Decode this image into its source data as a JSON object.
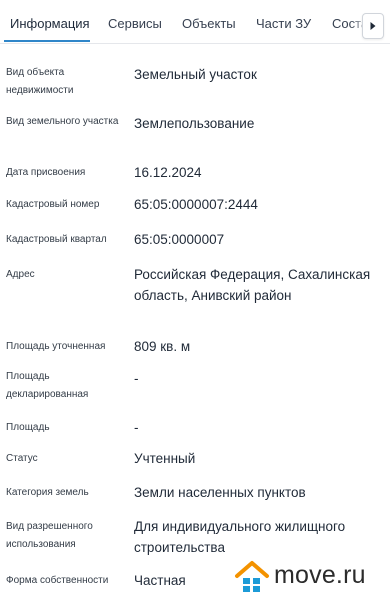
{
  "tabs": [
    {
      "label": "Информация",
      "active": true
    },
    {
      "label": "Сервисы",
      "active": false
    },
    {
      "label": "Объекты",
      "active": false
    },
    {
      "label": "Части ЗУ",
      "active": false
    },
    {
      "label": "Состав",
      "active": false
    }
  ],
  "tab_scroll_icon": "chevron-right-icon",
  "accent_color": "#2f86c9",
  "fields": [
    {
      "label": "Вид объекта недвижимости",
      "value": "Земельный участок"
    },
    {
      "label": "Вид земельного участка",
      "value": "Землепользование"
    },
    {
      "label": "Дата присвоения",
      "value": "16.12.2024"
    },
    {
      "label": "Кадастровый номер",
      "value": "65:05:0000007:2444"
    },
    {
      "label": "Кадастровый квартал",
      "value": "65:05:0000007"
    },
    {
      "label": "Адрес",
      "value": "Российская Федерация, Сахалинская область, Анивский район"
    },
    {
      "label": "Площадь уточненная",
      "value": "809 кв. м"
    },
    {
      "label": "Площадь декларированная",
      "value": "-"
    },
    {
      "label": "Площадь",
      "value": "-"
    },
    {
      "label": "Статус",
      "value": "Учтенный"
    },
    {
      "label": "Категория земель",
      "value": "Земли населенных пунктов"
    },
    {
      "label": "Вид разрешенного использования",
      "value": "Для индивидуального жилищного строительства"
    },
    {
      "label": "Форма собственности",
      "value": "Частная"
    }
  ],
  "watermark": {
    "text": "move.ru",
    "icon": "house-logo-icon",
    "roof_color": "#f39200",
    "body_color": "#1d9bd7"
  }
}
